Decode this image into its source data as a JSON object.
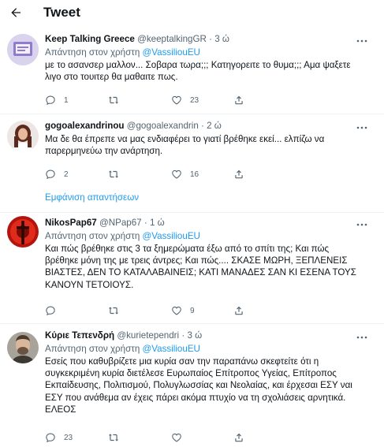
{
  "header": {
    "title": "Tweet"
  },
  "tweets": [
    {
      "name": "Keep Talking Greece",
      "handle": "@keeptalkingGR",
      "time": "3 ώ",
      "reply_prefix": "Απάντηση στον χρήστη",
      "reply_to": "@VassiliouEU",
      "text": "με το ασανσερ μαλλον... Σοβαρα τωρα;;; Κατηγορειτε το θυμα;;; Αμα ψαξετε λιγο στο τουιτερ θα μαθαιτε πως.",
      "replies": "1",
      "retweets": "",
      "likes": "23"
    },
    {
      "name": "gogoalexandrinou",
      "handle": "@gogoalexandrin",
      "time": "2 ώ",
      "text": "Μα δε θα έπρεπε να μας ενδιαφέρει το γιατί βρέθηκε εκεί... ελπίζω να παρερμηνεύω την ανάρτηση.",
      "replies": "2",
      "retweets": "",
      "likes": "16"
    },
    {
      "name": "NikosPap67",
      "handle": "@NPap67",
      "time": "1 ώ",
      "reply_prefix": "Απάντηση στον χρήστη",
      "reply_to": "@VassiliouEU",
      "text": "Και πώς βρέθηκε στις 3 τα ξημερώματα έξω από το σπίτι της; Και πώς βρέθηκε μόνη της με τρεις άντρες; Και πώς.... ΣΚΑΣΕ ΜΩΡΗ, ΞΕΠΛΕΝΕΙΣ ΒΙΑΣΤΕΣ, ΔΕΝ ΤΟ ΚΑΤΑΛΑΒΑΙΝΕΙΣ; ΚΑΤΙ ΜΑΝΑΔΕΣ ΣΑΝ ΚΙ ΕΣΕΝΑ ΤΟΥΣ ΚΑΝΟΥΝ ΤΕΤΟΙΟΥΣ.",
      "replies": "",
      "retweets": "",
      "likes": "9"
    },
    {
      "name": "Κύριε Τεπενδρή",
      "handle": "@kurietependri",
      "time": "3 ώ",
      "reply_prefix": "Απάντηση στον χρήστη",
      "reply_to": "@VassiliouEU",
      "text": "Εσείς που καθυβρίζετε μια κυρία σαν την παραπάνω σκεφτείτε ότι η συγκεκριμένη κυρία διετέλεσε Ευρωπαίος Επίτροπος Υγείας, Επίτροπος Εκπαίδευσης, Πολιτισμού, Πολυγλωσσίας και Νεολαίας, και έρχεσαι ΕΣΥ ναι ΕΣΥ που ανάθεμα αν έχεις πάρει ακόμα πτυχίο να τη σχολιάσεις αρνητικά. ΕΛΕΟΣ",
      "replies": "23",
      "retweets": "",
      "likes": ""
    }
  ],
  "show_replies": "Εμφάνιση απαντήσεων",
  "colors": {
    "accent": "#1d9bf0",
    "secondary_text": "#536471",
    "divider": "#eff3f4"
  },
  "icons": [
    "back-arrow-icon",
    "more-icon",
    "reply-icon",
    "retweet-icon",
    "like-icon",
    "share-icon"
  ]
}
